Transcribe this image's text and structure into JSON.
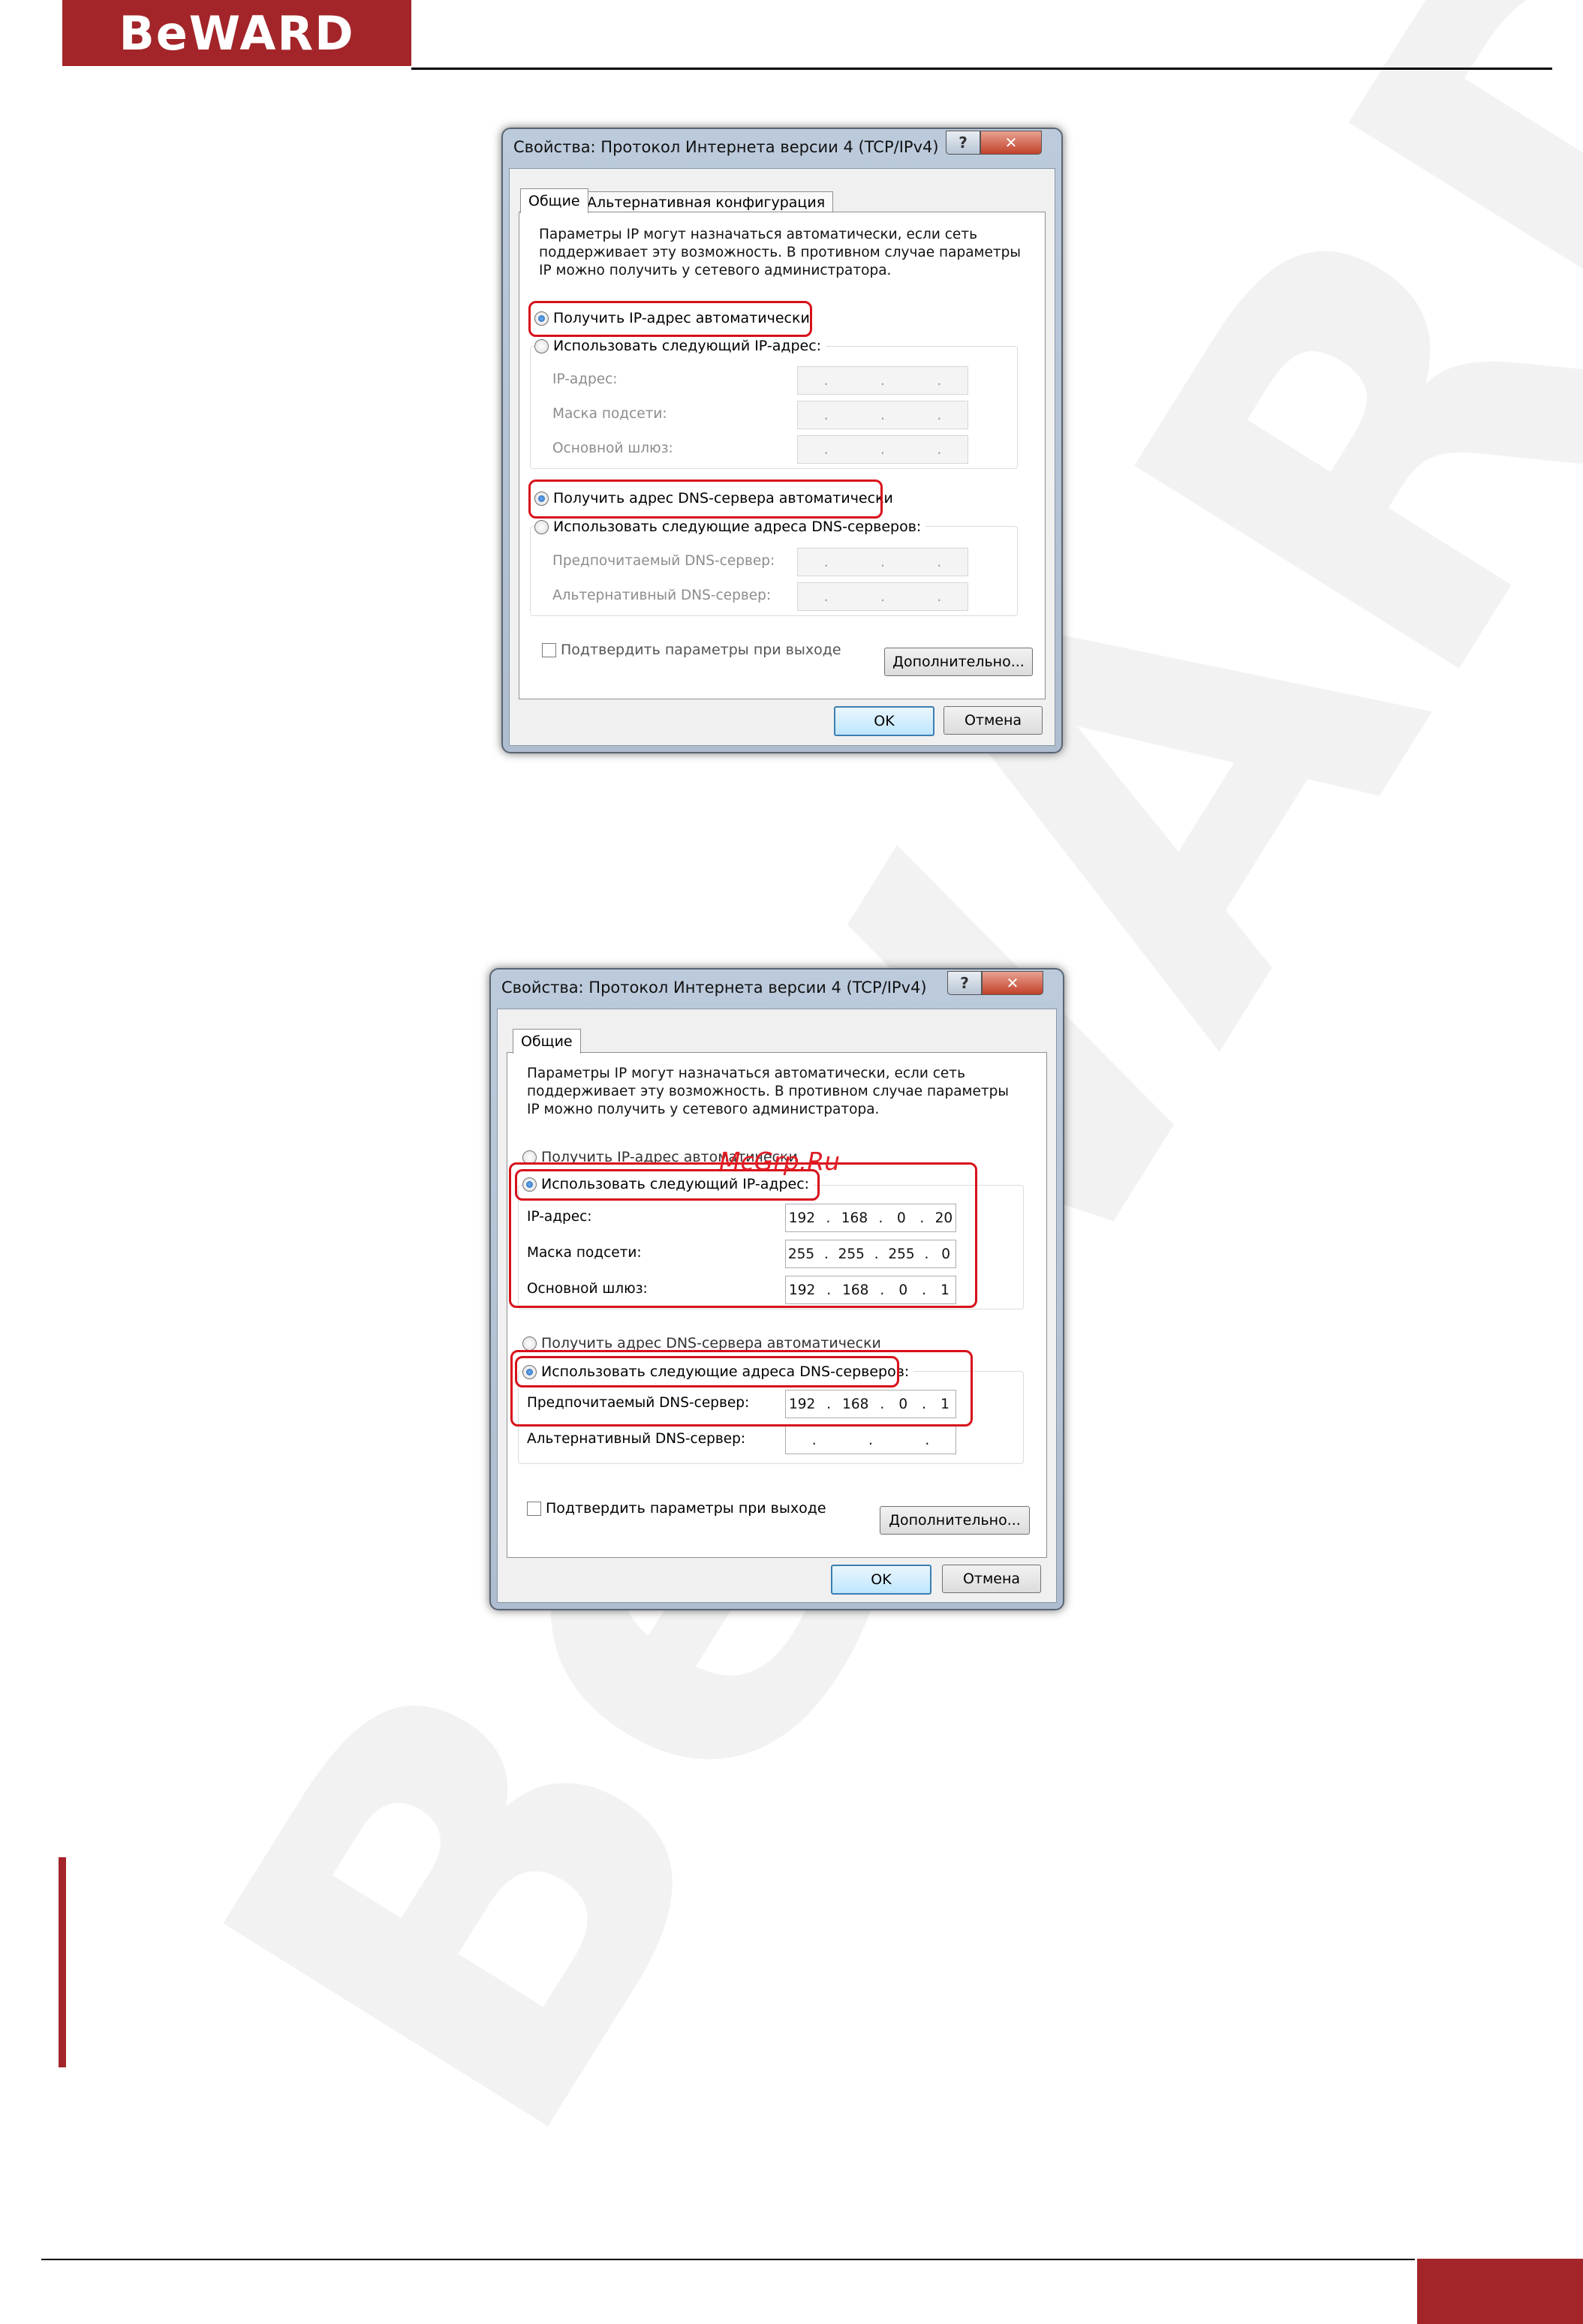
{
  "header": {
    "logo_text": "BeWARD"
  },
  "watermark_text": "BeWARD",
  "watermark_link": "McGrp.Ru",
  "colors": {
    "brand": "#a3252a",
    "highlight": "#d8111b"
  },
  "dialog1": {
    "title": "Свойства: Протокол Интернета версии 4 (TCP/IPv4)",
    "help_glyph": "?",
    "close_glyph": "✕",
    "tabs": [
      "Общие",
      "Альтернативная конфигурация"
    ],
    "description": [
      "Параметры IP могут назначаться автоматически, если сеть",
      "поддерживает эту возможность. В противном случае параметры",
      "IP можно получить у сетевого администратора."
    ],
    "radio_auto_ip": "Получить IP-адрес автоматически",
    "radio_manual_ip": "Использовать следующий IP-адрес:",
    "ip_label": "IP-адрес:",
    "mask_label": "Маска подсети:",
    "gateway_label": "Основной шлюз:",
    "radio_auto_dns": "Получить адрес DNS-сервера автоматически",
    "radio_manual_dns": "Использовать следующие адреса DNS-серверов:",
    "pref_dns_label": "Предпочитаемый DNS-сервер:",
    "alt_dns_label": "Альтернативный DNS-сервер:",
    "confirm_label": "Подтвердить параметры при выходе",
    "advanced_button": "Дополнительно...",
    "ok_button": "OK",
    "cancel_button": "Отмена",
    "empty_ip": [
      ".",
      ".",
      "."
    ]
  },
  "dialog2": {
    "title": "Свойства: Протокол Интернета версии 4 (TCP/IPv4)",
    "help_glyph": "?",
    "close_glyph": "✕",
    "tabs": [
      "Общие"
    ],
    "description": [
      "Параметры IP могут назначаться автоматически, если сеть",
      "поддерживает эту возможность. В противном случае параметры",
      "IP можно получить у сетевого администратора."
    ],
    "radio_auto_ip": "Получить IP-адрес автоматически",
    "radio_manual_ip": "Использовать следующий IP-адрес:",
    "ip_label": "IP-адрес:",
    "ip_value": [
      "192",
      ".",
      "168",
      ".",
      "0",
      ".",
      "20"
    ],
    "mask_label": "Маска подсети:",
    "mask_value": [
      "255",
      ".",
      "255",
      ".",
      "255",
      ".",
      "0"
    ],
    "gateway_label": "Основной шлюз:",
    "gateway_value": [
      "192",
      ".",
      "168",
      ".",
      "0",
      ".",
      "1"
    ],
    "radio_auto_dns": "Получить адрес DNS-сервера автоматически",
    "radio_manual_dns": "Использовать следующие адреса DNS-серверов:",
    "pref_dns_label": "Предпочитаемый DNS-сервер:",
    "pref_dns_value": [
      "192",
      ".",
      "168",
      ".",
      "0",
      ".",
      "1"
    ],
    "alt_dns_label": "Альтернативный DNS-сервер:",
    "alt_dns_value": [
      ".",
      ".",
      "."
    ],
    "confirm_label": "Подтвердить параметры при выходе",
    "advanced_button": "Дополнительно...",
    "ok_button": "OK",
    "cancel_button": "Отмена"
  }
}
